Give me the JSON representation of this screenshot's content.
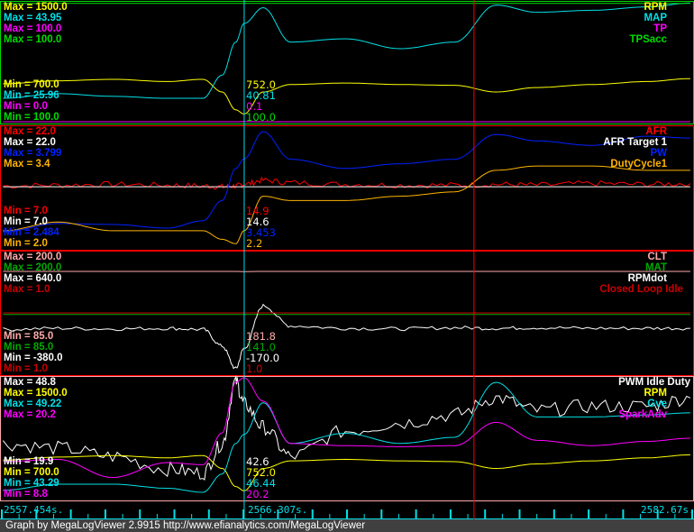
{
  "chart_data": {
    "type": "line",
    "x_label": "time (s)",
    "x_range": [
      2557.454,
      2582.67
    ],
    "cursor_time": 2566.307,
    "marker_time": 2574.7,
    "time_labels": {
      "start": "2557.454s.",
      "cursor": "2566.307s.",
      "end": "2582.67s."
    },
    "t": [
      2557.5,
      2559.5,
      2561.5,
      2563.5,
      2564.8,
      2565.5,
      2566.0,
      2566.3,
      2567.0,
      2568.0,
      2570.0,
      2572.0,
      2574.0,
      2575.5,
      2577.0,
      2579.0,
      2581.0,
      2582.6
    ],
    "panels": [
      {
        "series": [
          {
            "name": "RPM",
            "color": "#ffff00",
            "max_label": "Max = 1500.0",
            "min_label": "Min = 700.0",
            "cursor": "752.0",
            "min": 700,
            "max": 1500,
            "values": [
              955,
              975,
              985,
              970,
              985,
              900,
              780,
              752,
              900,
              950,
              960,
              950,
              945,
              900,
              930,
              950,
              970,
              990
            ]
          },
          {
            "name": "MAP",
            "color": "#00e0e8",
            "max_label": "Max = 43.95",
            "min_label": "Min = 25.96",
            "cursor": "40.81",
            "min": 25.96,
            "max": 43.95,
            "values": [
              29.5,
              30.2,
              29.8,
              29.5,
              29.5,
              33,
              38,
              40.81,
              43.2,
              38,
              38.5,
              37,
              38,
              43.6,
              42.5,
              42.8,
              43.3,
              43.9
            ]
          },
          {
            "name": "TP",
            "color": "#ff00ff",
            "max_label": "Max = 100.0",
            "min_label": "Min = 0.0",
            "cursor": "0.1",
            "min": 0,
            "max": 100,
            "values": [
              0,
              0,
              0,
              0,
              0,
              0,
              0,
              0.1,
              0,
              0,
              0,
              0,
              0,
              0,
              0,
              0,
              0,
              0
            ]
          },
          {
            "name": "TPSacc",
            "color": "#00dd00",
            "max_label": "Max = 100.0",
            "min_label": "Min = 100.0",
            "cursor": "100.0",
            "min": 100,
            "max": 100,
            "values": [
              100,
              100,
              100,
              100,
              100,
              100,
              100,
              100,
              100,
              100,
              100,
              100,
              100,
              100,
              100,
              100,
              100,
              100
            ]
          }
        ]
      },
      {
        "series": [
          {
            "name": "AFR",
            "color": "#ff0000",
            "max_label": "Max = 22.0",
            "min_label": "Min = 7.0",
            "cursor": "14.9",
            "min": 7,
            "max": 22,
            "values": [
              14.7,
              14.8,
              14.9,
              14.8,
              14.7,
              14.6,
              14.7,
              14.9,
              15.4,
              15.1,
              14.9,
              14.8,
              14.8,
              14.9,
              14.8,
              15.0,
              14.9,
              15.0
            ]
          },
          {
            "name": "AFR Target 1",
            "color": "#ffffff",
            "max_label": "Max = 22.0",
            "min_label": "Min = 7.0",
            "cursor": "14.6",
            "min": 7,
            "max": 22,
            "values": [
              14.6,
              14.6,
              14.6,
              14.6,
              14.6,
              14.6,
              14.6,
              14.6,
              14.6,
              14.6,
              14.6,
              14.6,
              14.6,
              14.6,
              14.6,
              14.6,
              14.6,
              14.6
            ]
          },
          {
            "name": "PW",
            "color": "#0022ff",
            "max_label": "Max = 3.799",
            "min_label": "Min = 2.484",
            "cursor": "3.453",
            "min": 2.484,
            "max": 3.799,
            "values": [
              2.66,
              2.75,
              2.74,
              2.7,
              2.78,
              3.0,
              3.35,
              3.453,
              3.75,
              3.45,
              3.35,
              3.4,
              3.45,
              3.72,
              3.65,
              3.6,
              3.7,
              3.68
            ]
          },
          {
            "name": "DutyCycle1",
            "color": "#ffb400",
            "max_label": "Max = 3.4",
            "min_label": "Min = 2.0",
            "cursor": "2.2",
            "min": 2.0,
            "max": 3.4,
            "values": [
              2.2,
              2.3,
              2.2,
              2.2,
              2.2,
              2.1,
              2.05,
              2.2,
              2.6,
              2.55,
              2.55,
              2.6,
              2.65,
              2.9,
              2.95,
              2.95,
              2.9,
              2.9
            ]
          }
        ]
      },
      {
        "series": [
          {
            "name": "CLT",
            "color": "#ffaaaa",
            "max_label": "Max = 200.0",
            "min_label": "Min = 85.0",
            "cursor": "181.8",
            "min": 85,
            "max": 200,
            "values": [
              182,
              182,
              182,
              182,
              182,
              182,
              182,
              181.8,
              182,
              182,
              182,
              182,
              182,
              182,
              182,
              182,
              182,
              182
            ]
          },
          {
            "name": "MAT",
            "color": "#00aa00",
            "max_label": "Max = 200.0",
            "min_label": "Min = 85.0",
            "cursor": "141.0",
            "min": 85,
            "max": 200,
            "values": [
              141,
              141,
              141,
              141,
              141,
              141,
              141,
              141,
              141,
              141,
              141,
              141,
              141,
              141,
              141,
              141,
              141,
              141
            ]
          },
          {
            "name": "RPMdot",
            "color": "#ffffff",
            "max_label": "Max = 640.0",
            "min_label": "Min = -380.0",
            "cursor": "-170.0",
            "min": -380,
            "max": 640,
            "values": [
              -10,
              0,
              -5,
              0,
              -10,
              -150,
              -340,
              -170,
              190,
              20,
              0,
              -5,
              5,
              0,
              5,
              0,
              0,
              0
            ]
          },
          {
            "name": "Closed Loop Idle",
            "color": "#cc0000",
            "max_label": "Max = 1.0",
            "min_label": "Min = 1.0",
            "cursor": "1.0",
            "min": 1,
            "max": 1,
            "values": [
              1,
              1,
              1,
              1,
              1,
              1,
              1,
              1,
              1,
              1,
              1,
              1,
              1,
              1,
              1,
              1,
              1,
              1
            ]
          }
        ]
      },
      {
        "series": [
          {
            "name": "PWM Idle Duty",
            "color": "#ffffff",
            "max_label": "Max = 48.8",
            "min_label": "Min = 19.9",
            "cursor": "42.6",
            "min": 19.9,
            "max": 48.8,
            "values": [
              33,
              32,
              30,
              27,
              26,
              33,
              48,
              42.6,
              37,
              30,
              36,
              38,
              40,
              44,
              41,
              42,
              42,
              44
            ]
          },
          {
            "name": "RPM",
            "color": "#ffff00",
            "max_label": "Max = 1500.0",
            "min_label": "Min = 700.0",
            "cursor": "752.0",
            "min": 700,
            "max": 1500,
            "values": [
              955,
              975,
              985,
              970,
              985,
              900,
              780,
              752,
              900,
              950,
              960,
              950,
              945,
              900,
              930,
              950,
              970,
              990
            ]
          },
          {
            "name": "Gve",
            "color": "#00e0e8",
            "max_label": "Max = 49.22",
            "min_label": "Min = 43.29",
            "cursor": "46.44",
            "min": 43.29,
            "max": 49.22,
            "values": [
              43.7,
              44.0,
              44.0,
              43.8,
              43.6,
              44.5,
              46.0,
              46.44,
              48.0,
              46.0,
              46.5,
              46.0,
              46.3,
              49.0,
              47.3,
              47.3,
              47.4,
              47.5
            ]
          },
          {
            "name": "SparkAdv",
            "color": "#ff00ff",
            "max_label": "Max = 20.2",
            "min_label": "Min = 8.8",
            "cursor": "20.2",
            "min": 8.8,
            "max": 20.2,
            "values": [
              12.3,
              12.5,
              10.8,
              12.2,
              12.0,
              15,
              19.8,
              20.2,
              18,
              14,
              13.8,
              13.7,
              13.8,
              16,
              14.3,
              13.8,
              14.2,
              14.5
            ]
          }
        ]
      }
    ]
  },
  "footer": "Graph by MegaLogViewer 2.9915 http://www.efianalytics.com/MegaLogViewer"
}
